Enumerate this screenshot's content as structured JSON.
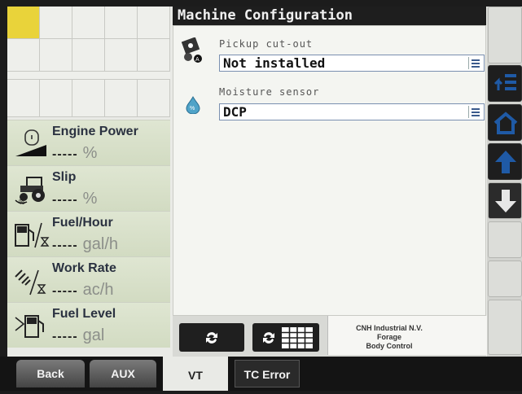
{
  "panel": {
    "title": "Machine Configuration",
    "fields": [
      {
        "label": "Pickup cut-out",
        "value": "Not installed",
        "icon": "pickup-gear-icon"
      },
      {
        "label": "Moisture sensor",
        "value": "DCP",
        "icon": "moisture-drop-icon"
      }
    ],
    "buttons": [
      {
        "icon": "cycle-arrows-icon"
      },
      {
        "icon": "cycle-grid-icon"
      }
    ],
    "brand": {
      "line1": "CNH Industrial N.V.",
      "line2": "Forage",
      "line3": "Body Control"
    }
  },
  "widgets": [
    {
      "title": "Engine Power",
      "value": "-----",
      "unit": "%",
      "icon": "engine-icon"
    },
    {
      "title": "Slip",
      "value": "-----",
      "unit": "%",
      "icon": "tractor-slip-icon"
    },
    {
      "title": "Fuel/Hour",
      "value": "-----",
      "unit": "gal/h",
      "icon": "fuel-pump-hourglass-icon"
    },
    {
      "title": "Work Rate",
      "value": "-----",
      "unit": "ac/h",
      "icon": "field-rate-icon"
    },
    {
      "title": "Fuel Level",
      "value": "-----",
      "unit": "gal",
      "icon": "fuel-level-icon"
    }
  ],
  "tabs": [
    {
      "label": "Back"
    },
    {
      "label": "AUX"
    },
    {
      "label": "VT",
      "active": true
    },
    {
      "label": "TC Error"
    }
  ],
  "colors": {
    "accent_blue": "#1f5aa6",
    "grid_highlight": "#e9d33a",
    "title_bar": "#1e1e1e"
  }
}
